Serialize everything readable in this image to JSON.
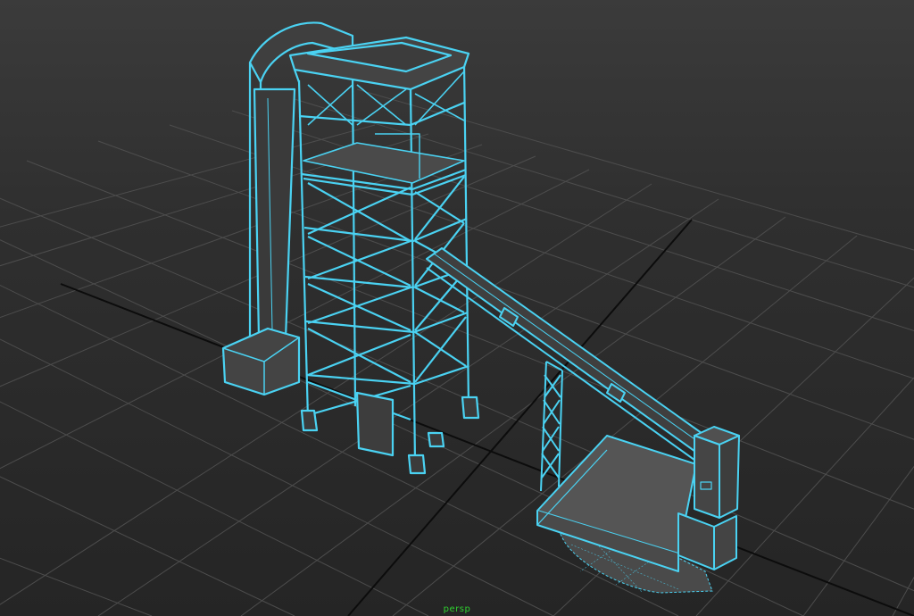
{
  "viewport": {
    "camera_name": "persp",
    "background_color": "#2b2b2b",
    "grid_color": "#505050",
    "axis_color": "#0a0a0a",
    "wire_color": "#4ad2f2",
    "mesh_fill_color": "#3f3f3f",
    "model": "mine-headframe-with-conveyor"
  }
}
